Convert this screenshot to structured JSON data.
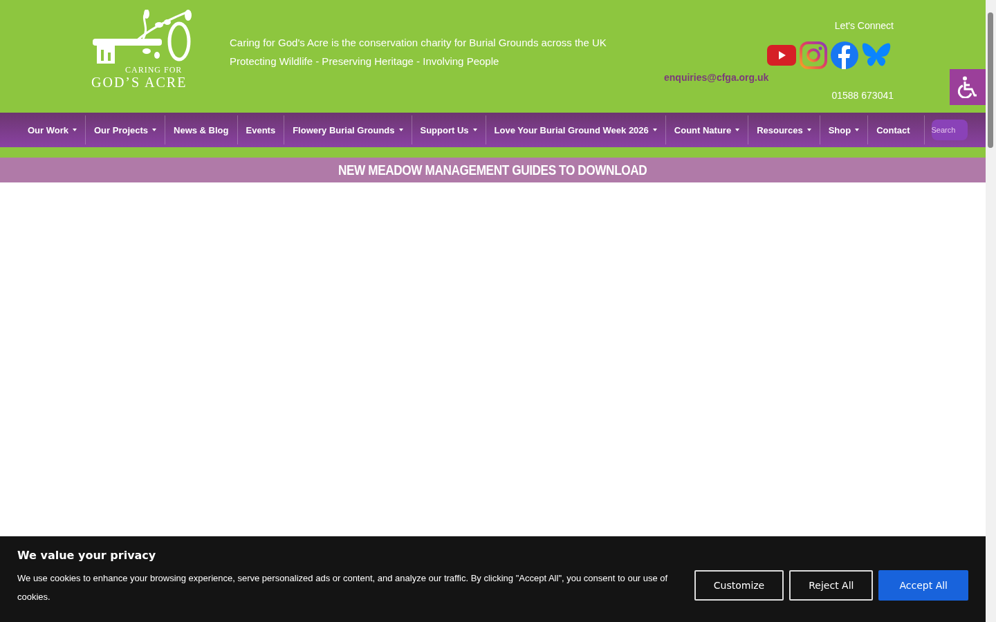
{
  "header": {
    "logo": {
      "line_1": "CARING FOR",
      "line_2": "GOD’S ACRE"
    },
    "tagline": [
      "Caring for God's Acre is the conservation charity for Burial Grounds across the UK",
      "Protecting Wildlife - Preserving Heritage - Involving People"
    ],
    "connect": {
      "heading": "Let's Connect",
      "email": "enquiries@cfga.org.uk",
      "phone": "01588 673041"
    }
  },
  "nav": {
    "items": [
      {
        "label": "Our Work",
        "has_menu": true
      },
      {
        "label": "Our Projects",
        "has_menu": true
      },
      {
        "label": "News & Blog",
        "has_menu": false
      },
      {
        "label": "Events",
        "has_menu": false
      },
      {
        "label": "Flowery Burial Grounds",
        "has_menu": true
      },
      {
        "label": "Support Us",
        "has_menu": true
      },
      {
        "label": "Love Your Burial Ground Week 2026",
        "has_menu": true
      },
      {
        "label": "Count Nature",
        "has_menu": true
      },
      {
        "label": "Resources",
        "has_menu": true
      },
      {
        "label": "Shop",
        "has_menu": true
      },
      {
        "label": "Contact",
        "has_menu": false
      }
    ],
    "search": {
      "placeholder": "Search"
    }
  },
  "banner": {
    "text": "NEW MEADOW MANAGEMENT GUIDES TO DOWNLOAD"
  },
  "cookie_notice": {
    "title": "We value your privacy",
    "text": "We use cookies to enhance your browsing experience, serve personalized ads or content, and analyze our traffic. By clicking \"Accept All\", you consent to our use of cookies.",
    "buttons": [
      {
        "label": "Customize",
        "kind": "outline"
      },
      {
        "label": "Reject All",
        "kind": "outline"
      },
      {
        "label": "Accept All",
        "kind": "primary"
      }
    ]
  }
}
